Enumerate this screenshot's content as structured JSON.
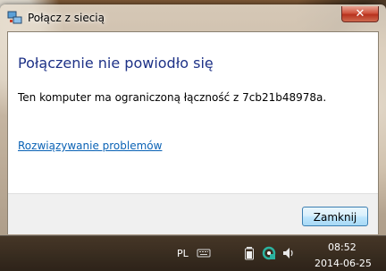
{
  "window": {
    "title": "Połącz z siecią",
    "close_glyph": "✕"
  },
  "content": {
    "heading": "Połączenie nie powiodło się",
    "message": "Ten komputer ma ograniczoną łączność z 7cb21b48978a.",
    "troubleshoot_link": "Rozwiązywanie problemów"
  },
  "footer": {
    "close_button": "Zamknij"
  },
  "taskbar": {
    "language": "PL",
    "tray_icons": [
      "keyboard-icon",
      "battery-icon",
      "network-icon",
      "volume-icon"
    ],
    "time": "08:52",
    "date": "2014-06-25"
  },
  "colors": {
    "heading": "#1e3287",
    "link": "#0a62b5"
  }
}
